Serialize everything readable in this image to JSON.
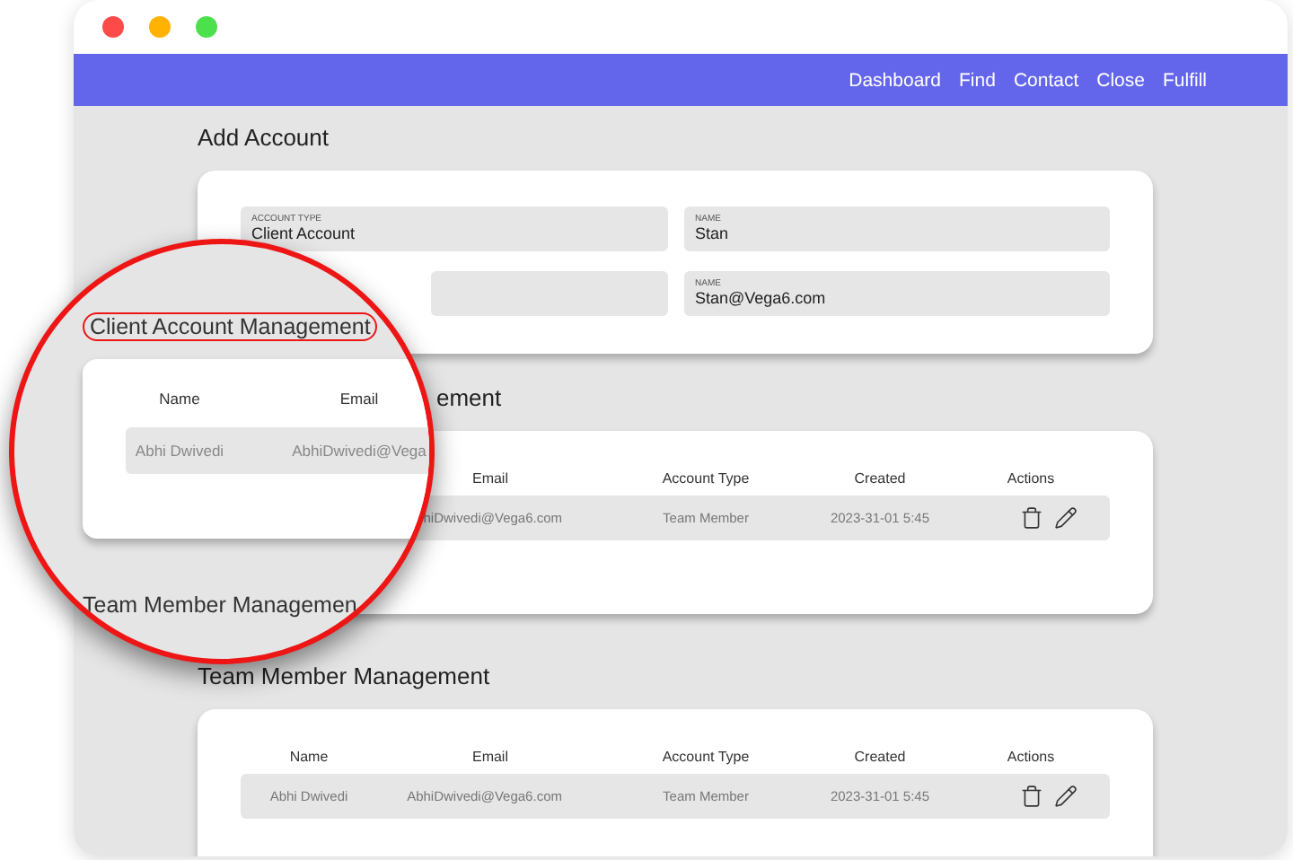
{
  "nav": [
    "Dashboard",
    "Find",
    "Contact",
    "Close",
    "Fulfill"
  ],
  "add_account": {
    "title": "Add Account",
    "fields": [
      {
        "kind": "filled",
        "label": "ACCOUNT TYPE",
        "value": "Client Account"
      },
      {
        "kind": "filled",
        "label": "NAME",
        "value": "Stan"
      },
      {
        "kind": "blank"
      },
      {
        "kind": "filled",
        "label": "NAME",
        "value": "Stan@Vega6.com"
      }
    ]
  },
  "sections": [
    {
      "title": "ement",
      "covered": true,
      "columns": [
        {},
        {
          "label": "Email"
        },
        {
          "label": "Account Type"
        },
        {
          "label": "Created"
        },
        {
          "label": "Actions"
        }
      ],
      "rows": [
        {
          "cells": [
            {},
            {
              "text": "hiDwivedi@Vega6.com"
            },
            {
              "text": "Team Member"
            },
            {
              "text": "2023-31-01  5:45"
            }
          ]
        }
      ]
    },
    {
      "title": "Team Member Management",
      "covered": false,
      "columns": [
        {
          "label": "Name"
        },
        {
          "label": "Email"
        },
        {
          "label": "Account Type"
        },
        {
          "label": "Created"
        },
        {
          "label": "Actions"
        }
      ],
      "rows": [
        {
          "cells": [
            {
              "text": "Abhi Dwivedi"
            },
            {
              "text": "AbhiDwivedi@Vega6.com"
            },
            {
              "text": "Team Member"
            },
            {
              "text": "2023-31-01  5:45"
            }
          ]
        }
      ]
    }
  ],
  "magnifier": {
    "heading": "Client Account Management",
    "columns": [
      "Name",
      "Email"
    ],
    "row": [
      "Abhi Dwivedi",
      "AbhiDwivedi@Vega"
    ],
    "next_heading": "Team Member Managemen"
  }
}
